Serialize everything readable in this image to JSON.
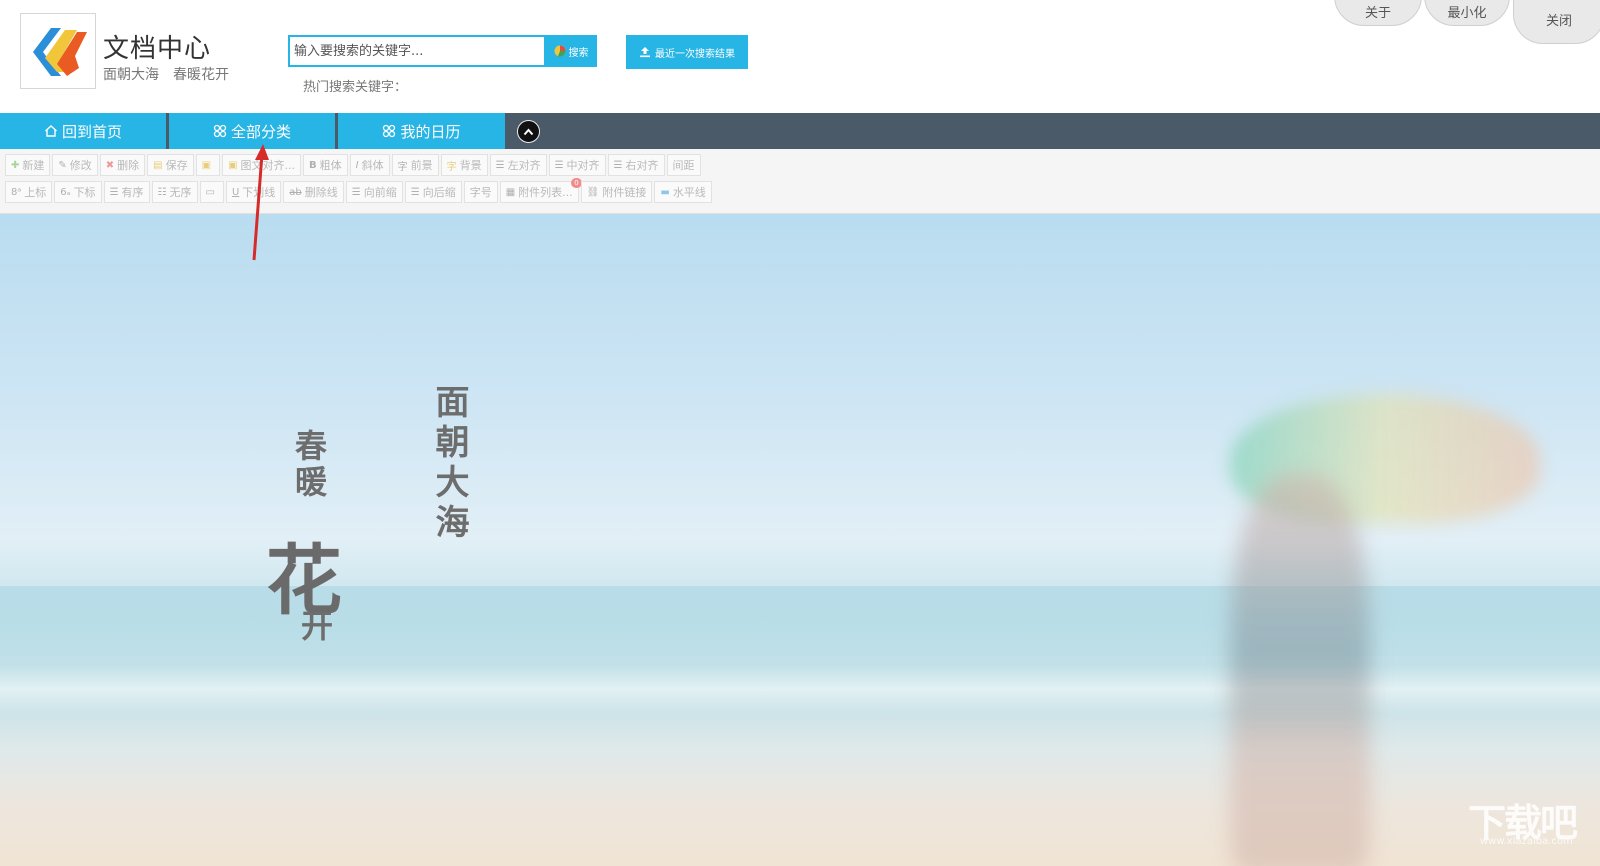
{
  "app": {
    "title": "文档中心",
    "subtitle": "面朝大海　春暖花开"
  },
  "search": {
    "placeholder": "输入要搜索的关键字...",
    "button_label": "搜索",
    "recent_label": "最近一次搜索结果",
    "hot_label": "热门搜索关键字："
  },
  "window_controls": {
    "about": "关于",
    "minimize": "最小化",
    "close": "关闭"
  },
  "nav": {
    "tabs": [
      {
        "label": "回到首页",
        "icon": "home-icon"
      },
      {
        "label": "全部分类",
        "icon": "grid-icon"
      },
      {
        "label": "我的日历",
        "icon": "grid-icon"
      }
    ]
  },
  "toolbar": {
    "row1": [
      {
        "label": "新建",
        "icon": "new-icon"
      },
      {
        "label": "修改",
        "icon": "edit-icon"
      },
      {
        "label": "删除",
        "icon": "delete-icon"
      },
      {
        "label": "保存",
        "icon": "save-icon"
      },
      {
        "label": "",
        "icon": "image-icon"
      },
      {
        "label": "图文对齐...",
        "icon": "image-align-icon"
      },
      {
        "label": "粗体",
        "icon": "bold-icon"
      },
      {
        "label": "斜体",
        "icon": "italic-icon"
      },
      {
        "label": "前景",
        "icon": "foreground-icon"
      },
      {
        "label": "背景",
        "icon": "background-icon"
      },
      {
        "label": "左对齐",
        "icon": "align-left-icon"
      },
      {
        "label": "中对齐",
        "icon": "align-center-icon"
      },
      {
        "label": "右对齐",
        "icon": "align-right-icon"
      },
      {
        "label": "间距",
        "icon": "spacing-icon"
      }
    ],
    "row2": [
      {
        "label": "上标",
        "icon": "superscript-icon"
      },
      {
        "label": "下标",
        "icon": "subscript-icon"
      },
      {
        "label": "有序",
        "icon": "ordered-list-icon"
      },
      {
        "label": "无序",
        "icon": "unordered-list-icon"
      },
      {
        "label": "",
        "icon": "border-icon"
      },
      {
        "label": "下划线",
        "icon": "underline-icon"
      },
      {
        "label": "删除线",
        "icon": "strikethrough-icon"
      },
      {
        "label": "向前缩",
        "icon": "outdent-icon"
      },
      {
        "label": "向后缩",
        "icon": "indent-icon"
      },
      {
        "label": "字号",
        "icon": "font-size-icon"
      },
      {
        "label": "附件列表...",
        "icon": "attachment-list-icon",
        "badge": "0"
      },
      {
        "label": "附件链接",
        "icon": "attachment-link-icon"
      },
      {
        "label": "水平线",
        "icon": "horizontal-line-icon"
      }
    ]
  },
  "hero": {
    "poem_left": "春暖",
    "poem_big": "花",
    "poem_small": "开",
    "poem_right": "面朝大海"
  },
  "watermark": {
    "text": "下载吧",
    "url": "www.xiazaiba.com"
  },
  "colors": {
    "accent": "#27b5e5",
    "nav_dark": "#4a5a68",
    "annotation_arrow": "#d62b2b"
  }
}
